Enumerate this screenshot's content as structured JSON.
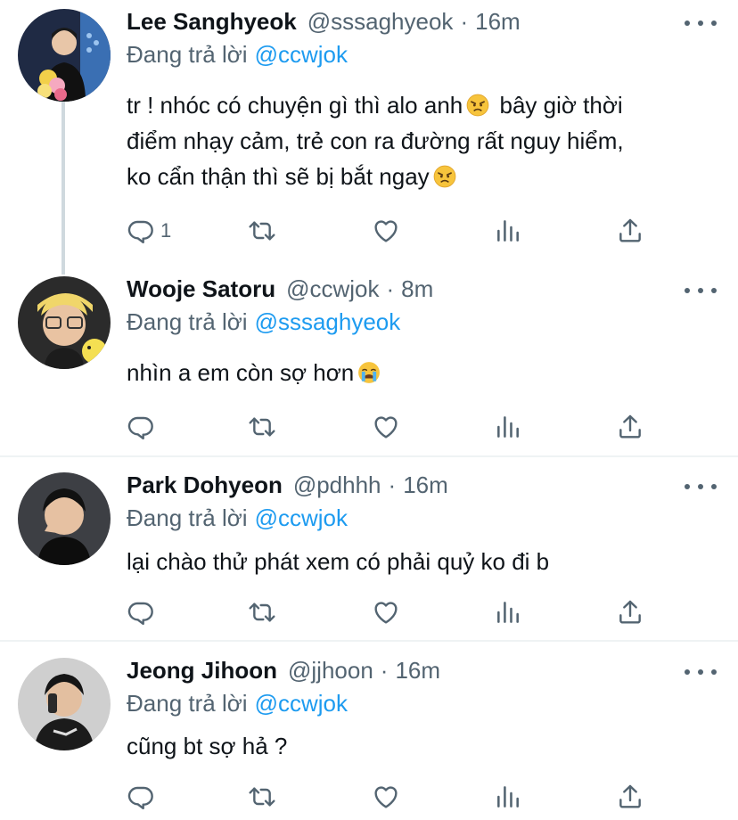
{
  "tweets": [
    {
      "name": "Lee Sanghyeok",
      "handle": "@sssaghyeok",
      "separator": "·",
      "time": "16m",
      "reply_prefix": "Đang trả lời",
      "reply_to": "@ccwjok",
      "lines": [
        "tr ! nhóc có chuyện gì thì alo anh",
        "bây giờ thời",
        "điểm nhạy cảm, trẻ con ra đường rất nguy hiểm,",
        "ko cẩn thận thì sẽ bị bắt ngay"
      ],
      "reply_count": "1"
    },
    {
      "name": "Wooje Satoru",
      "handle": "@ccwjok",
      "separator": "·",
      "time": "8m",
      "reply_prefix": "Đang trả lời",
      "reply_to": "@sssaghyeok",
      "text": "nhìn a em còn sợ hơn"
    },
    {
      "name": "Park Dohyeon",
      "handle": "@pdhhh",
      "separator": "·",
      "time": "16m",
      "reply_prefix": "Đang trả lời",
      "reply_to": "@ccwjok",
      "text": "lại chào thử phát xem có phải quỷ ko đi b"
    },
    {
      "name": "Jeong Jihoon",
      "handle": "@jjhoon",
      "separator": "·",
      "time": "16m",
      "reply_prefix": "Đang trả lời",
      "reply_to": "@ccwjok",
      "text": "cũng bt sợ hả ?"
    }
  ],
  "icons": {
    "reply": "reply-icon",
    "retweet": "retweet-icon",
    "like": "heart-icon",
    "analytics": "analytics-icon",
    "share": "share-icon",
    "more": "more-icon",
    "angry_emoji": "angry-face-emoji",
    "crying_emoji": "loudly-crying-face-emoji"
  },
  "colors": {
    "text": "#0f1419",
    "secondary": "#536471",
    "link": "#1d9bf0",
    "divider": "#eff3f4",
    "thread_line": "#cfd9de"
  }
}
